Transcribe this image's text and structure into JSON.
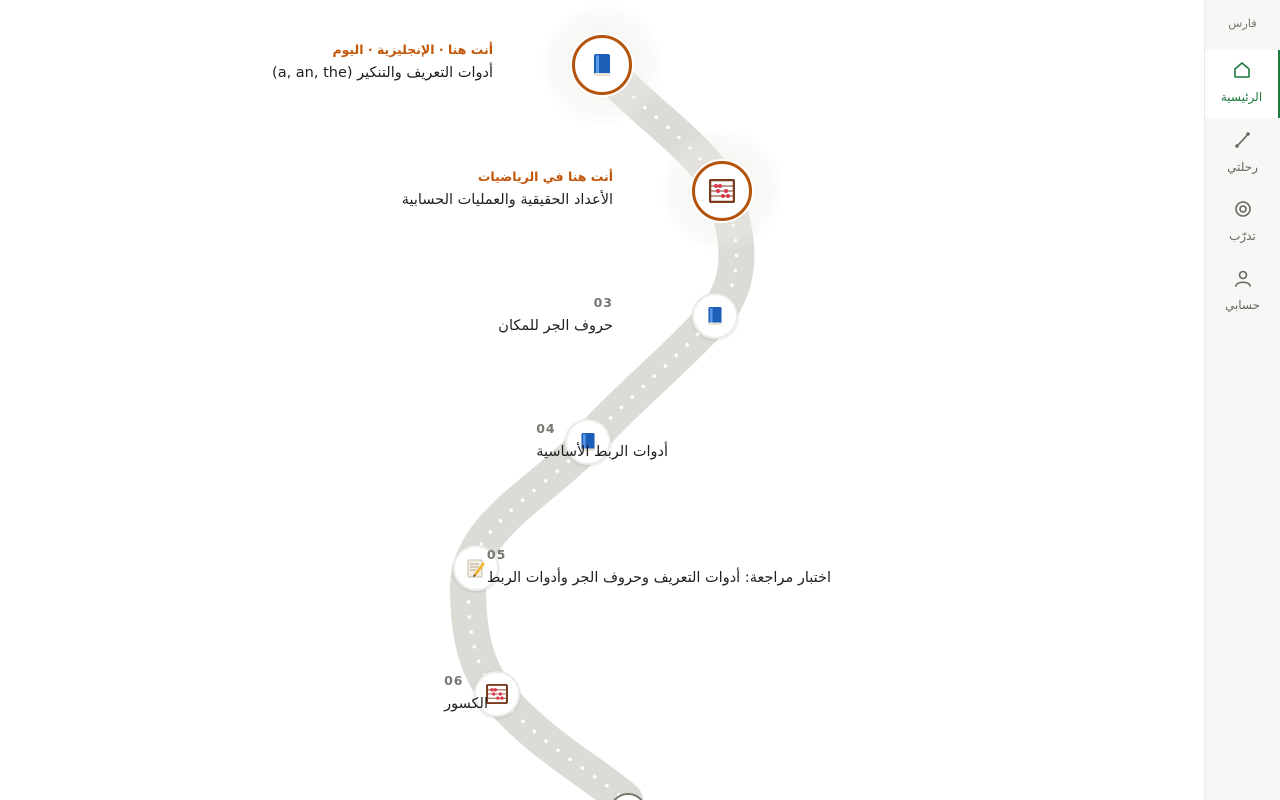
{
  "sidebar": {
    "brand": "فارس",
    "items": [
      {
        "label": "الرئيسية",
        "icon": "home-icon",
        "active": true
      },
      {
        "label": "رحلتي",
        "icon": "journey-icon",
        "active": false
      },
      {
        "label": "تدرّب",
        "icon": "practice-icon",
        "active": false
      },
      {
        "label": "حسابي",
        "icon": "account-icon",
        "active": false
      }
    ]
  },
  "path": {
    "nodes": [
      {
        "meta": "أنت هنا · الإنجليزية · اليوم",
        "title": "أدوات التعريف والتنكير (a, an, the)",
        "icon": "book-icon",
        "active": true
      },
      {
        "meta": "أنت هنا في الرياضيات",
        "title": "الأعداد الحقيقية والعمليات الحسابية",
        "icon": "abacus-icon",
        "active": true
      },
      {
        "num": "03",
        "title": "حروف الجر للمكان",
        "icon": "book-icon",
        "active": false
      },
      {
        "num": "04",
        "title": "أدوات الربط الأساسية",
        "icon": "book-icon",
        "active": false
      },
      {
        "num": "05",
        "title": "اختبار مراجعة: أدوات التعريف وحروف الجر وأدوات الربط",
        "icon": "memo-icon",
        "active": false
      },
      {
        "num": "06",
        "title": "الكسور",
        "icon": "abacus-icon",
        "active": false
      }
    ]
  }
}
